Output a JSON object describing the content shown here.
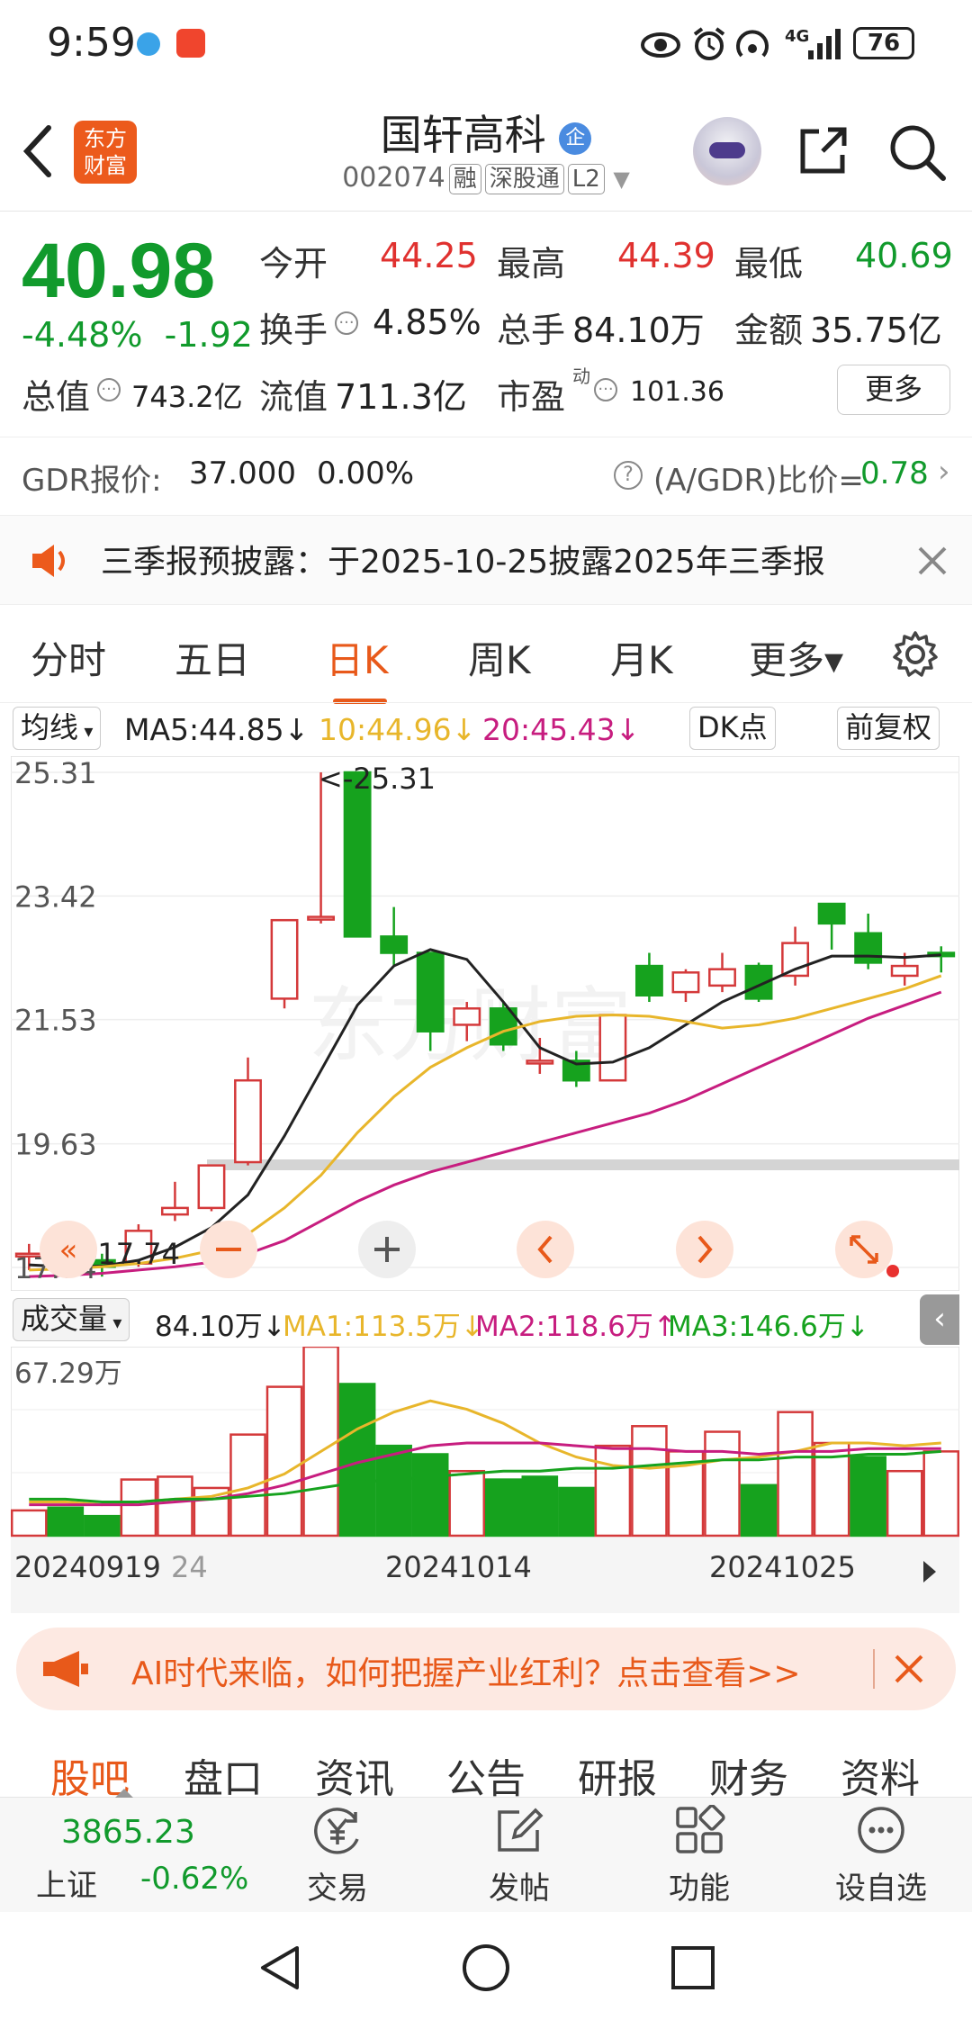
{
  "status": {
    "time": "9:59",
    "network": "4G",
    "battery": "76"
  },
  "header": {
    "stock_name": "国轩高科",
    "name_badge": "企",
    "code": "002074",
    "tags": [
      "融",
      "深股通",
      "L2"
    ],
    "logo_text_1": "东方",
    "logo_text_2": "财富"
  },
  "quote": {
    "price": "40.98",
    "pct": "-4.48%",
    "change": "-1.92",
    "open_label": "今开",
    "open": "44.25",
    "high_label": "最高",
    "high": "44.39",
    "low_label": "最低",
    "low": "40.69",
    "turnover_label": "换手",
    "turnover": "4.85%",
    "volume_label": "总手",
    "volume": "84.10万",
    "amount_label": "金额",
    "amount": "35.75亿",
    "mcap_label": "总值",
    "mcap": "743.2亿",
    "float_label": "流值",
    "float": "711.3亿",
    "pe_label": "市盈",
    "pe_sup": "动",
    "pe": "101.36",
    "more": "更多"
  },
  "gdr": {
    "label": "GDR报价:",
    "price": "37.000",
    "pct": "0.00%",
    "ratio_label": "(A/GDR)比价=",
    "ratio": "0.78"
  },
  "notice": {
    "text": "三季报预披露：于2025-10-25披露2025年三季报"
  },
  "tabs": [
    "分时",
    "五日",
    "日K",
    "周K",
    "月K",
    "更多▾"
  ],
  "ma": {
    "select": "均线",
    "ma5": "MA5:44.85↓",
    "ma10": "10:44.96↓",
    "ma20": "20:45.43↓",
    "dk": "DK点",
    "adjust": "前复权"
  },
  "kline": {
    "y_labels": [
      "25.31",
      "23.42",
      "21.53",
      "19.63",
      "17.74"
    ],
    "max_note": "<-25.31",
    "min_note": "<-17.74",
    "watermark": "东方财富"
  },
  "vol": {
    "select": "成交量",
    "vol": "84.10万↓",
    "ma1": "MA1:113.5万↓",
    "ma2": "MA2:118.6万↑",
    "ma3": "MA3:146.6万↓",
    "y_label": "67.29万",
    "dates": [
      "20240919",
      "24",
      "20241014",
      "20241025"
    ]
  },
  "chart_data": [
    {
      "type": "candlestick",
      "title": "",
      "ylim": [
        17.74,
        25.31
      ],
      "y_ticks": [
        25.31,
        23.42,
        21.53,
        19.63,
        17.74
      ],
      "candles": [
        {
          "o": 17.95,
          "c": 17.95,
          "h": 18.1,
          "l": 17.7
        },
        {
          "o": 17.7,
          "c": 17.8,
          "h": 17.95,
          "l": 17.65
        },
        {
          "o": 17.85,
          "c": 17.75,
          "h": 17.95,
          "l": 17.6
        },
        {
          "o": 17.8,
          "c": 18.3,
          "h": 18.4,
          "l": 17.75
        },
        {
          "o": 18.55,
          "c": 18.65,
          "h": 19.05,
          "l": 18.45
        },
        {
          "o": 18.65,
          "c": 19.3,
          "h": 19.3,
          "l": 18.6
        },
        {
          "o": 19.35,
          "c": 20.6,
          "h": 20.95,
          "l": 19.3
        },
        {
          "o": 21.85,
          "c": 23.05,
          "h": 23.05,
          "l": 21.7
        },
        {
          "o": 23.1,
          "c": 23.1,
          "h": 25.31,
          "l": 23.0
        },
        {
          "o": 25.31,
          "c": 22.8,
          "h": 25.31,
          "l": 22.8
        },
        {
          "o": 22.8,
          "c": 22.55,
          "h": 23.25,
          "l": 22.35
        },
        {
          "o": 22.55,
          "c": 21.35,
          "h": 22.55,
          "l": 21.05
        },
        {
          "o": 21.45,
          "c": 21.7,
          "h": 21.8,
          "l": 21.2
        },
        {
          "o": 21.7,
          "c": 21.15,
          "h": 21.8,
          "l": 21.05
        },
        {
          "o": 20.9,
          "c": 20.9,
          "h": 21.25,
          "l": 20.7
        },
        {
          "o": 20.9,
          "c": 20.6,
          "h": 21.05,
          "l": 20.5
        },
        {
          "o": 20.6,
          "c": 21.6,
          "h": 21.6,
          "l": 20.6
        },
        {
          "o": 22.35,
          "c": 21.9,
          "h": 22.55,
          "l": 21.8
        },
        {
          "o": 21.95,
          "c": 22.25,
          "h": 22.3,
          "l": 21.8
        },
        {
          "o": 22.05,
          "c": 22.3,
          "h": 22.55,
          "l": 21.95
        },
        {
          "o": 22.35,
          "c": 21.85,
          "h": 22.4,
          "l": 21.8
        },
        {
          "o": 22.2,
          "c": 22.7,
          "h": 22.95,
          "l": 22.05
        },
        {
          "o": 23.3,
          "c": 23.0,
          "h": 23.3,
          "l": 22.6
        },
        {
          "o": 22.85,
          "c": 22.4,
          "h": 23.15,
          "l": 22.3
        },
        {
          "o": 22.2,
          "c": 22.35,
          "h": 22.55,
          "l": 22.05
        },
        {
          "o": 22.55,
          "c": 22.5,
          "h": 22.65,
          "l": 22.25
        }
      ],
      "series": [
        {
          "values": [
            17.78,
            17.75,
            17.76,
            17.85,
            18.05,
            18.35,
            18.85,
            19.75,
            20.75,
            21.75,
            22.35,
            22.6,
            22.45,
            21.8,
            21.1,
            20.85,
            20.88,
            21.1,
            21.45,
            21.8,
            22.05,
            22.3,
            22.5,
            22.5,
            22.48,
            22.52
          ]
        },
        {
          "values": [
            17.7,
            17.72,
            17.75,
            17.8,
            17.88,
            18.0,
            18.25,
            18.65,
            19.15,
            19.8,
            20.35,
            20.8,
            21.1,
            21.35,
            21.5,
            21.58,
            21.6,
            21.58,
            21.5,
            21.4,
            21.45,
            21.55,
            21.7,
            21.85,
            22.0,
            22.2
          ]
        },
        {
          "values": [
            17.6,
            17.62,
            17.65,
            17.7,
            17.75,
            17.82,
            17.95,
            18.15,
            18.45,
            18.75,
            19.0,
            19.2,
            19.35,
            19.5,
            19.65,
            19.8,
            19.95,
            20.1,
            20.3,
            20.55,
            20.8,
            21.05,
            21.3,
            21.55,
            21.75,
            21.95
          ]
        }
      ]
    },
    {
      "type": "bar",
      "title": "",
      "ylim": [
        0,
        67.29
      ],
      "values": [
        9,
        10,
        7,
        20,
        21,
        17,
        36,
        53,
        67.29,
        54,
        32,
        29,
        23,
        20,
        21,
        17,
        32,
        39,
        30,
        37,
        18,
        44,
        33,
        28,
        23,
        30
      ],
      "up": [
        true,
        false,
        false,
        true,
        true,
        true,
        true,
        true,
        true,
        false,
        false,
        false,
        true,
        false,
        false,
        false,
        true,
        true,
        true,
        true,
        false,
        true,
        true,
        false,
        true,
        true
      ],
      "series": [
        {
          "values": [
            12,
            12,
            11,
            12,
            13,
            14,
            17,
            22,
            30,
            38,
            44,
            48,
            45,
            40,
            33,
            28,
            25,
            24,
            25,
            27,
            28,
            30,
            33,
            33,
            32,
            33
          ]
        },
        {
          "values": [
            11,
            11,
            11,
            11,
            12,
            13,
            15,
            18,
            22,
            26,
            29,
            32,
            33,
            33,
            33,
            32,
            31,
            31,
            30,
            30,
            29,
            30,
            30,
            31,
            31,
            31
          ]
        },
        {
          "values": [
            13,
            13,
            12,
            12,
            13,
            13,
            14,
            15,
            17,
            19,
            20,
            21,
            22,
            23,
            23,
            24,
            24,
            25,
            26,
            27,
            27,
            28,
            28,
            29,
            29,
            30
          ]
        }
      ]
    }
  ],
  "ad": {
    "text": "AI时代来临，如何把握产业红利？点击查看>>"
  },
  "bottom_tabs": [
    "股吧",
    "盘口",
    "资讯",
    "公告",
    "研报",
    "财务",
    "资料"
  ],
  "index": {
    "value": "3865.23",
    "name": "上证",
    "pct": "-0.62%"
  },
  "bottom_bar": [
    "交易",
    "发帖",
    "功能",
    "设自选"
  ],
  "colors": {
    "up": "#d4393a",
    "down": "#16a21e",
    "ma5": "#222222",
    "ma10": "#e8b62b",
    "ma20": "#c71d7f",
    "accent": "#e8591a"
  }
}
